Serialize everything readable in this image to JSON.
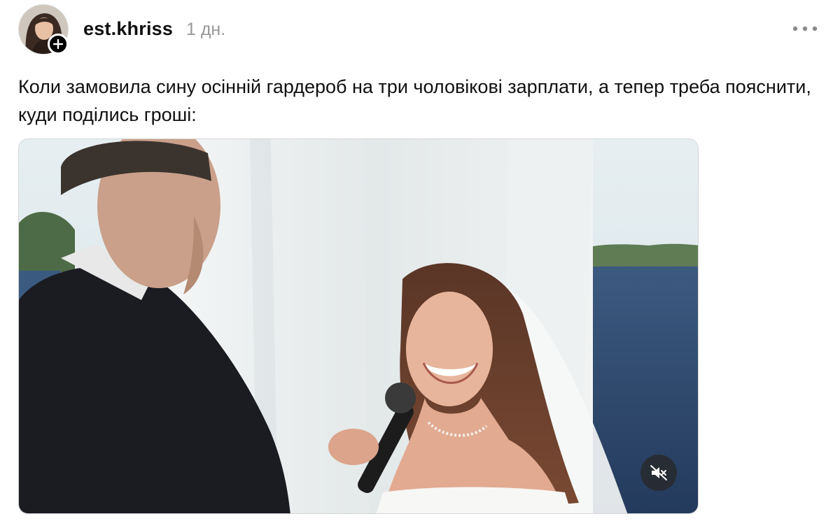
{
  "post": {
    "username": "est.khriss",
    "timestamp": "1 дн.",
    "caption": "Коли замовила сину осінній гардероб на три чоловікові зарплати, а тепер треба пояснити, куди поділись гроші:"
  },
  "icons": {
    "follow": "plus-icon",
    "more": "more-horizontal-icon",
    "mute": "speaker-muted-icon"
  },
  "colors": {
    "text": "#101010",
    "muted": "#999999",
    "badge": "#000000",
    "sky": "#dfe8ec",
    "water": "#2f4d75"
  },
  "media": {
    "type": "video",
    "muted": true
  }
}
